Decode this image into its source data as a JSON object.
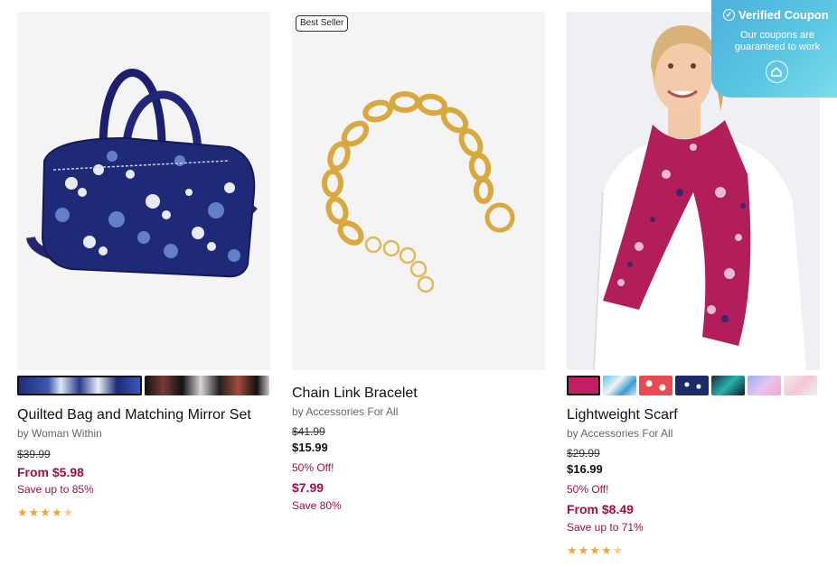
{
  "products": [
    {
      "title": "Quilted Bag and Matching Mirror Set",
      "brand": "by Woman Within",
      "original_price": "$39.99",
      "from_price": "From $5.98",
      "save": "Save up to 85%",
      "rating": 4.5
    },
    {
      "badge": "Best Seller",
      "title": "Chain Link Bracelet",
      "brand": "by Accessories For All",
      "original_price": "$41.99",
      "current_price": "$15.99",
      "discount": "50% Off!",
      "sale_price": "$7.99",
      "save": "Save 80%"
    },
    {
      "title": "Lightweight Scarf",
      "brand": "by Accessories For All",
      "original_price": "$29.99",
      "current_price": "$16.99",
      "discount": "50% Off!",
      "from_price": "From $8.49",
      "save": "Save up to 71%",
      "rating": 4.5
    }
  ],
  "coupon": {
    "title": "Verified Coupon",
    "text": "Our coupons are guaranteed to work",
    "icon": "coupon-icon"
  },
  "colors": {
    "sale": "#a50d45",
    "star": "#f0a43c",
    "coupon_bg": "#4cb0dc"
  }
}
